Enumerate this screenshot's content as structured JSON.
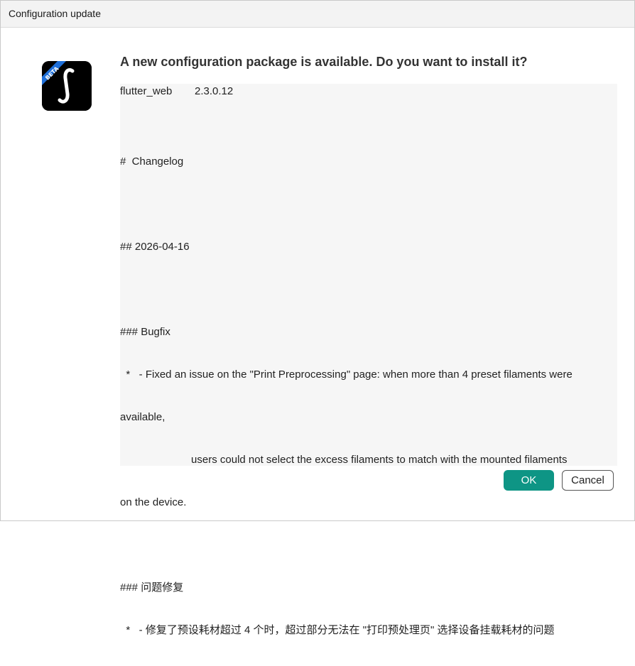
{
  "window": {
    "title": "Configuration update"
  },
  "app_icon": {
    "name": "flutter-web-beta-icon",
    "badge": "BETA",
    "badge_color": "#1e6fd9",
    "background": "#000000"
  },
  "dialog": {
    "headline": "A new configuration package is available. Do you want to install it?",
    "package": {
      "name": "flutter_web",
      "version": "2.3.0.12"
    },
    "changelog": {
      "heading": "#  Changelog",
      "date": "## 2026-04-16",
      "bugfix_heading": "### Bugfix",
      "bugfix_line1": "  *   - Fixed an issue on the \"Print Preprocessing\" page: when more than 4 preset filaments were",
      "bugfix_line2": "available,",
      "bugfix_line3": "                        users could not select the excess filaments to match with the mounted filaments",
      "bugfix_line4": "on the device.",
      "cn_heading": "### 问题修复",
      "cn_line1": "  *   - 修复了预设耗材超过 4 个时，超过部分无法在 \"打印预处理页\" 选择设备挂载耗材的问题"
    }
  },
  "buttons": {
    "ok_label": "OK",
    "cancel_label": "Cancel"
  },
  "colors": {
    "accent": "#0e9585",
    "content_bg": "#f6f6f6",
    "titlebar_bg": "#f3f3f3"
  }
}
